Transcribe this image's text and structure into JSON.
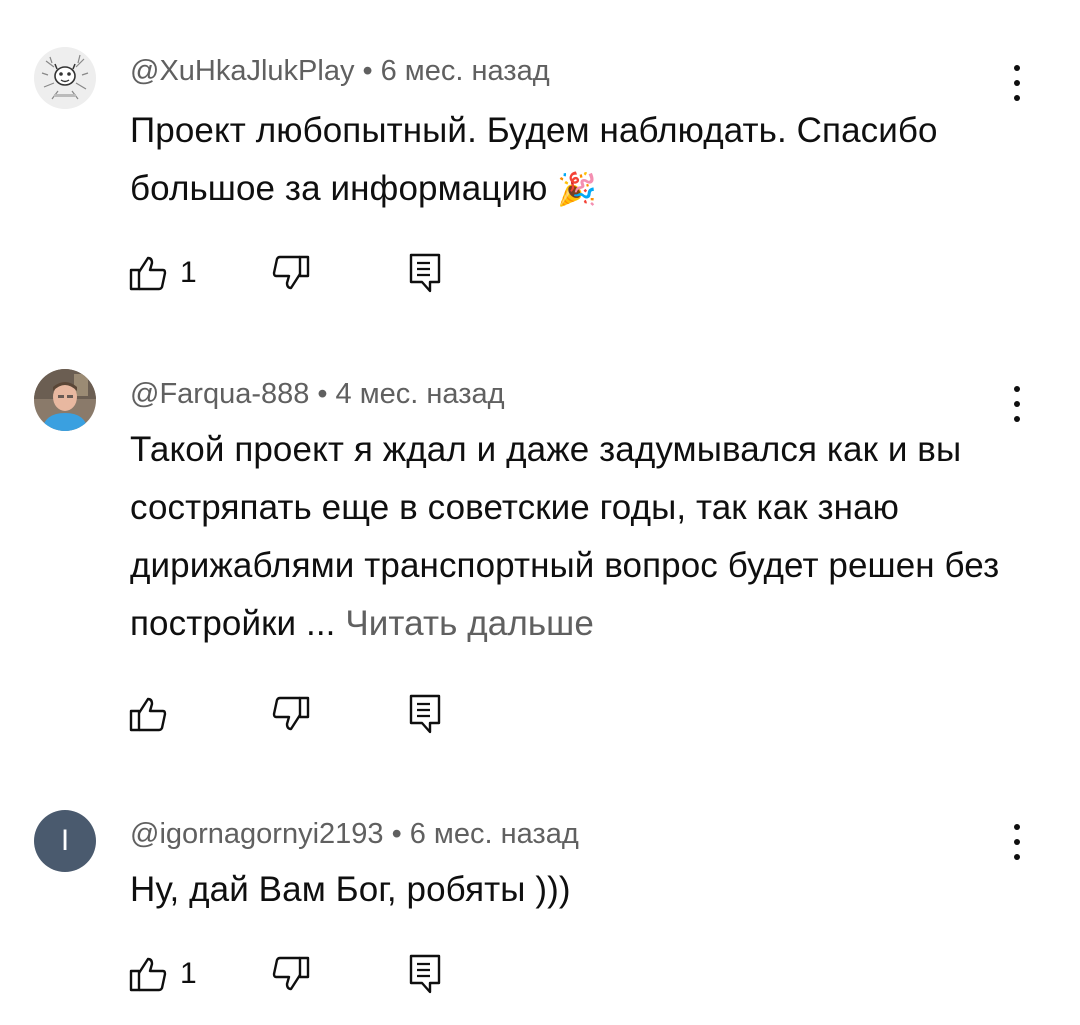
{
  "comments": [
    {
      "author": "@XuHkaJlukPlay",
      "time": "6 мес. назад",
      "text": "Проект любопытный. Будем наблюдать. Спасибо большое за информацию ",
      "emoji": "🎉",
      "likes": "1",
      "avatar_type": "logo"
    },
    {
      "author": "@Farqua-888",
      "time": "4 мес. назад",
      "text": "Такой проект я ждал и даже задумывался как и вы состряпать еще в советские годы, так как знаю дирижаблями транспортный вопрос будет решен без постройки ... ",
      "read_more": "Читать дальше",
      "likes": "",
      "avatar_type": "photo"
    },
    {
      "author": "@igornagornyi2193",
      "time": "6 мес. назад",
      "text": "Ну, дай Вам Бог, робяты )))",
      "likes": "1",
      "avatar_type": "letter",
      "avatar_letter": "I",
      "avatar_color": "#4a5a6e"
    }
  ],
  "separator": "•",
  "icons": {
    "like": "thumbs-up-icon",
    "dislike": "thumbs-down-icon",
    "reply": "reply-comment-icon",
    "menu": "more-vertical-icon"
  }
}
